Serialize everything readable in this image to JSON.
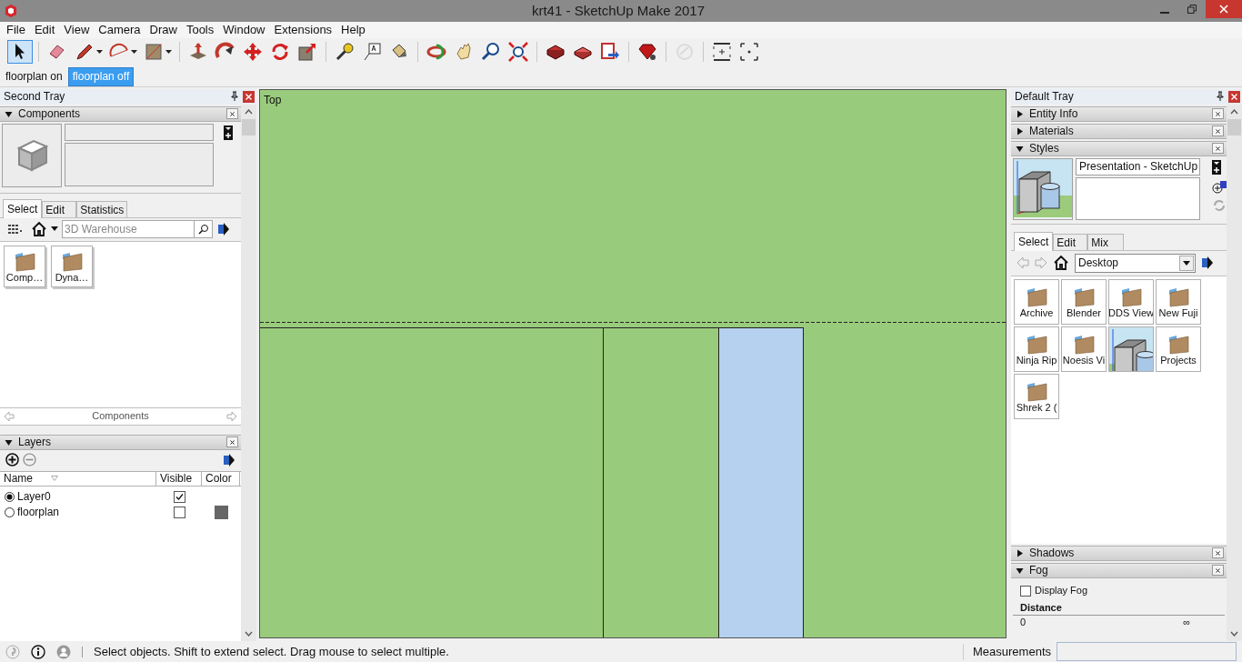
{
  "window": {
    "title": "krt41 - SketchUp Make 2017"
  },
  "menu": [
    "File",
    "Edit",
    "View",
    "Camera",
    "Draw",
    "Tools",
    "Window",
    "Extensions",
    "Help"
  ],
  "toolbar": [
    {
      "selected": true,
      "disabled": false
    },
    {
      "selected": false,
      "disabled": false
    },
    {
      "selected": false,
      "disabled": false
    },
    {
      "selected": false,
      "disabled": false
    },
    {
      "selected": false,
      "disabled": false
    },
    {
      "selected": false,
      "disabled": false
    },
    {
      "selected": false,
      "disabled": false
    },
    {
      "selected": false,
      "disabled": false
    },
    {
      "selected": false,
      "disabled": false
    },
    {
      "selected": false,
      "disabled": false
    },
    {
      "selected": false,
      "disabled": false
    },
    {
      "selected": false,
      "disabled": false
    },
    {
      "selected": false,
      "disabled": false
    },
    {
      "selected": false,
      "disabled": false
    },
    {
      "selected": false,
      "disabled": false
    },
    {
      "selected": false,
      "disabled": false
    },
    {
      "selected": false,
      "disabled": false
    },
    {
      "selected": false,
      "disabled": false
    },
    {
      "selected": false,
      "disabled": false
    },
    {
      "selected": false,
      "disabled": false
    },
    {
      "selected": false,
      "disabled": false
    },
    {
      "selected": false,
      "disabled": true
    },
    {
      "selected": false,
      "disabled": false
    },
    {
      "selected": false,
      "disabled": false
    }
  ],
  "scene_tabs": [
    {
      "label": "floorplan on",
      "selected": false
    },
    {
      "label": "floorplan off",
      "selected": true
    }
  ],
  "left_tray": {
    "title": "Second Tray",
    "components": {
      "title": "Components",
      "expanded": true,
      "tabs": [
        {
          "label": "Select",
          "selected": true
        },
        {
          "label": "Edit",
          "selected": false
        },
        {
          "label": "Statistics",
          "selected": false
        }
      ],
      "search": {
        "placeholder": "3D Warehouse"
      },
      "items": [
        {
          "label": "Comp…"
        },
        {
          "label": "Dyna…"
        }
      ],
      "nav_label": "Components"
    },
    "layers": {
      "title": "Layers",
      "expanded": true,
      "columns": [
        "Name",
        "Visible",
        "Color"
      ],
      "rows": [
        {
          "name": "Layer0",
          "active": true,
          "visible": true
        },
        {
          "name": "floorplan",
          "active": false,
          "visible": false,
          "color": "#666666"
        }
      ]
    }
  },
  "viewport": {
    "view_label": "Top"
  },
  "right_tray": {
    "title": "Default Tray",
    "panels": [
      {
        "title": "Entity Info",
        "expanded": false
      },
      {
        "title": "Materials",
        "expanded": false
      },
      {
        "title": "Styles",
        "expanded": true
      }
    ],
    "styles": {
      "name": "Presentation - SketchUp",
      "tabs": [
        {
          "label": "Select",
          "selected": true
        },
        {
          "label": "Edit",
          "selected": false
        },
        {
          "label": "Mix",
          "selected": false
        }
      ],
      "location": "Desktop",
      "items": [
        {
          "kind": "folder",
          "label": "Archive"
        },
        {
          "kind": "folder",
          "label": "Blender"
        },
        {
          "kind": "folder",
          "label": "DDS View"
        },
        {
          "kind": "folder",
          "label": "New Fuji"
        },
        {
          "kind": "folder",
          "label": "Ninja Rip"
        },
        {
          "kind": "folder",
          "label": "Noesis Vi"
        },
        {
          "kind": "style"
        },
        {
          "kind": "folder",
          "label": "Projects"
        },
        {
          "kind": "folder",
          "label": "Shrek 2 ("
        }
      ]
    },
    "bottom_panels": [
      {
        "title": "Shadows",
        "expanded": false
      },
      {
        "title": "Fog",
        "expanded": true
      }
    ],
    "fog": {
      "display_fog": false,
      "label": "Display Fog",
      "distance_label": "Distance",
      "near": "0",
      "far": "∞"
    }
  },
  "status_bar": {
    "message": "Select objects. Shift to extend select. Drag mouse to select multiple.",
    "measurements_label": "Measurements"
  }
}
